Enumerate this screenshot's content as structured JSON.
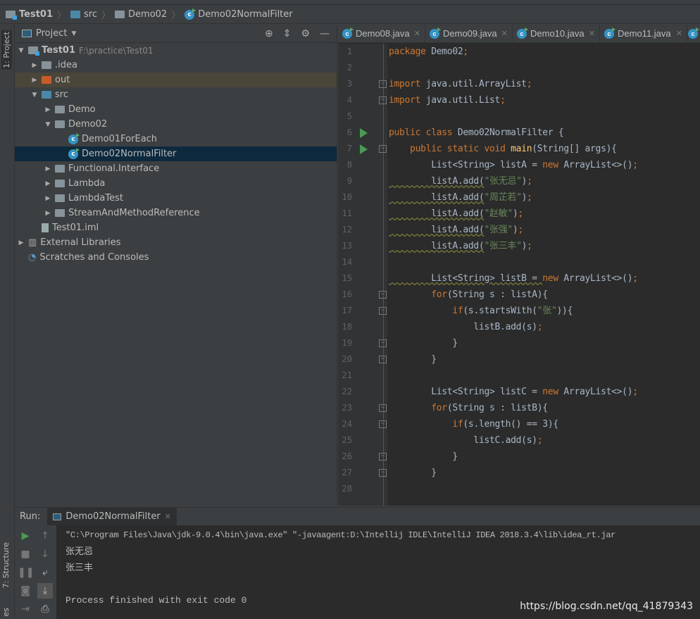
{
  "breadcrumb": [
    "Test01",
    "src",
    "Demo02",
    "Demo02NormalFilter"
  ],
  "left_stripe": {
    "project": "1: Project",
    "structure": "7: Structure",
    "bottom": "es"
  },
  "project_panel": {
    "title": "Project",
    "tree": [
      {
        "label": "Test01",
        "path": "F:\\practice\\Test01",
        "depth": 0,
        "arrow": "down",
        "icon": "module-folder"
      },
      {
        "label": ".idea",
        "depth": 1,
        "arrow": "right",
        "icon": "folder"
      },
      {
        "label": "out",
        "depth": 1,
        "arrow": "right",
        "icon": "folder-orange"
      },
      {
        "label": "src",
        "depth": 1,
        "arrow": "down",
        "icon": "folder-blue"
      },
      {
        "label": "Demo",
        "depth": 2,
        "arrow": "right",
        "icon": "package"
      },
      {
        "label": "Demo02",
        "depth": 2,
        "arrow": "down",
        "icon": "package"
      },
      {
        "label": "Demo01ForEach",
        "depth": 3,
        "arrow": "",
        "icon": "class"
      },
      {
        "label": "Demo02NormalFilter",
        "depth": 3,
        "arrow": "",
        "icon": "class",
        "selected": true
      },
      {
        "label": "Functional.Interface",
        "depth": 2,
        "arrow": "right",
        "icon": "package"
      },
      {
        "label": "Lambda",
        "depth": 2,
        "arrow": "right",
        "icon": "package"
      },
      {
        "label": "LambdaTest",
        "depth": 2,
        "arrow": "right",
        "icon": "package"
      },
      {
        "label": "StreamAndMethodReference",
        "depth": 2,
        "arrow": "right",
        "icon": "package"
      },
      {
        "label": "Test01.iml",
        "depth": 1,
        "arrow": "",
        "icon": "file"
      },
      {
        "label": "External Libraries",
        "depth": 0,
        "arrow": "right",
        "icon": "library"
      },
      {
        "label": "Scratches and Consoles",
        "depth": 0,
        "arrow": "",
        "icon": "scratches"
      }
    ]
  },
  "editor_tabs": [
    "Demo08.java",
    "Demo09.java",
    "Demo10.java",
    "Demo11.java"
  ],
  "code": [
    [
      [
        "k",
        "package "
      ],
      [
        "t",
        "Demo02"
      ],
      [
        "k",
        ";"
      ]
    ],
    [],
    [
      [
        "k",
        "import "
      ],
      [
        "t",
        "java.util.ArrayList"
      ],
      [
        "k",
        ";"
      ]
    ],
    [
      [
        "k",
        "import "
      ],
      [
        "t",
        "java.util.List"
      ],
      [
        "k",
        ";"
      ]
    ],
    [],
    [
      [
        "k",
        "public class "
      ],
      [
        "t",
        "Demo02NormalFilter {"
      ]
    ],
    [
      [
        "t",
        "    "
      ],
      [
        "k",
        "public static void "
      ],
      [
        "m",
        "main"
      ],
      [
        "t",
        "(String[] args){"
      ]
    ],
    [
      [
        "t",
        "        List<String> listA = "
      ],
      [
        "k",
        "new "
      ],
      [
        "t",
        "ArrayList<>()"
      ],
      [
        "k",
        ";"
      ]
    ],
    [
      [
        "t",
        "        listA.add("
      ],
      [
        "s",
        "\"张无忌\""
      ],
      [
        "t",
        ")"
      ],
      [
        "k",
        ";"
      ]
    ],
    [
      [
        "t",
        "        listA.add("
      ],
      [
        "s",
        "\"周芷若\""
      ],
      [
        "t",
        ")"
      ],
      [
        "k",
        ";"
      ]
    ],
    [
      [
        "t",
        "        listA.add("
      ],
      [
        "s",
        "\"赵敏\""
      ],
      [
        "t",
        ")"
      ],
      [
        "k",
        ";"
      ]
    ],
    [
      [
        "t",
        "        listA.add("
      ],
      [
        "s",
        "\"张强\""
      ],
      [
        "t",
        ")"
      ],
      [
        "k",
        ";"
      ]
    ],
    [
      [
        "t",
        "        listA.add("
      ],
      [
        "s",
        "\"张三丰\""
      ],
      [
        "t",
        ")"
      ],
      [
        "k",
        ";"
      ]
    ],
    [],
    [
      [
        "t",
        "        List<String> listB = "
      ],
      [
        "k",
        "new "
      ],
      [
        "t",
        "ArrayList<>()"
      ],
      [
        "k",
        ";"
      ]
    ],
    [
      [
        "t",
        "        "
      ],
      [
        "k",
        "for"
      ],
      [
        "t",
        "(String s : listA){"
      ]
    ],
    [
      [
        "t",
        "            "
      ],
      [
        "k",
        "if"
      ],
      [
        "t",
        "(s.startsWith("
      ],
      [
        "s",
        "\"张\""
      ],
      [
        "t",
        ")){"
      ]
    ],
    [
      [
        "t",
        "                listB.add(s)"
      ],
      [
        "k",
        ";"
      ]
    ],
    [
      [
        "t",
        "            }"
      ]
    ],
    [
      [
        "t",
        "        }"
      ]
    ],
    [],
    [
      [
        "t",
        "        List<String> listC = "
      ],
      [
        "k",
        "new "
      ],
      [
        "t",
        "ArrayList<>()"
      ],
      [
        "k",
        ";"
      ]
    ],
    [
      [
        "t",
        "        "
      ],
      [
        "k",
        "for"
      ],
      [
        "t",
        "(String s : listB){"
      ]
    ],
    [
      [
        "t",
        "            "
      ],
      [
        "k",
        "if"
      ],
      [
        "t",
        "(s.length() == 3){"
      ]
    ],
    [
      [
        "t",
        "                listC.add(s)"
      ],
      [
        "k",
        ";"
      ]
    ],
    [
      [
        "t",
        "            }"
      ]
    ],
    [
      [
        "t",
        "        }"
      ]
    ],
    []
  ],
  "run_markers": [
    6,
    7
  ],
  "fold_markers": [
    3,
    4,
    7,
    16,
    17,
    19,
    20,
    23,
    24,
    26,
    27
  ],
  "run_panel": {
    "label": "Run:",
    "tab": "Demo02NormalFilter",
    "console": [
      "\"C:\\Program Files\\Java\\jdk-9.0.4\\bin\\java.exe\" \"-javaagent:D:\\Intellij IDLE\\IntelliJ IDEA 2018.3.4\\lib\\idea_rt.jar",
      "张无忌",
      "张三丰",
      "",
      "Process finished with exit code 0"
    ]
  },
  "watermark": "https://blog.csdn.net/qq_41879343"
}
